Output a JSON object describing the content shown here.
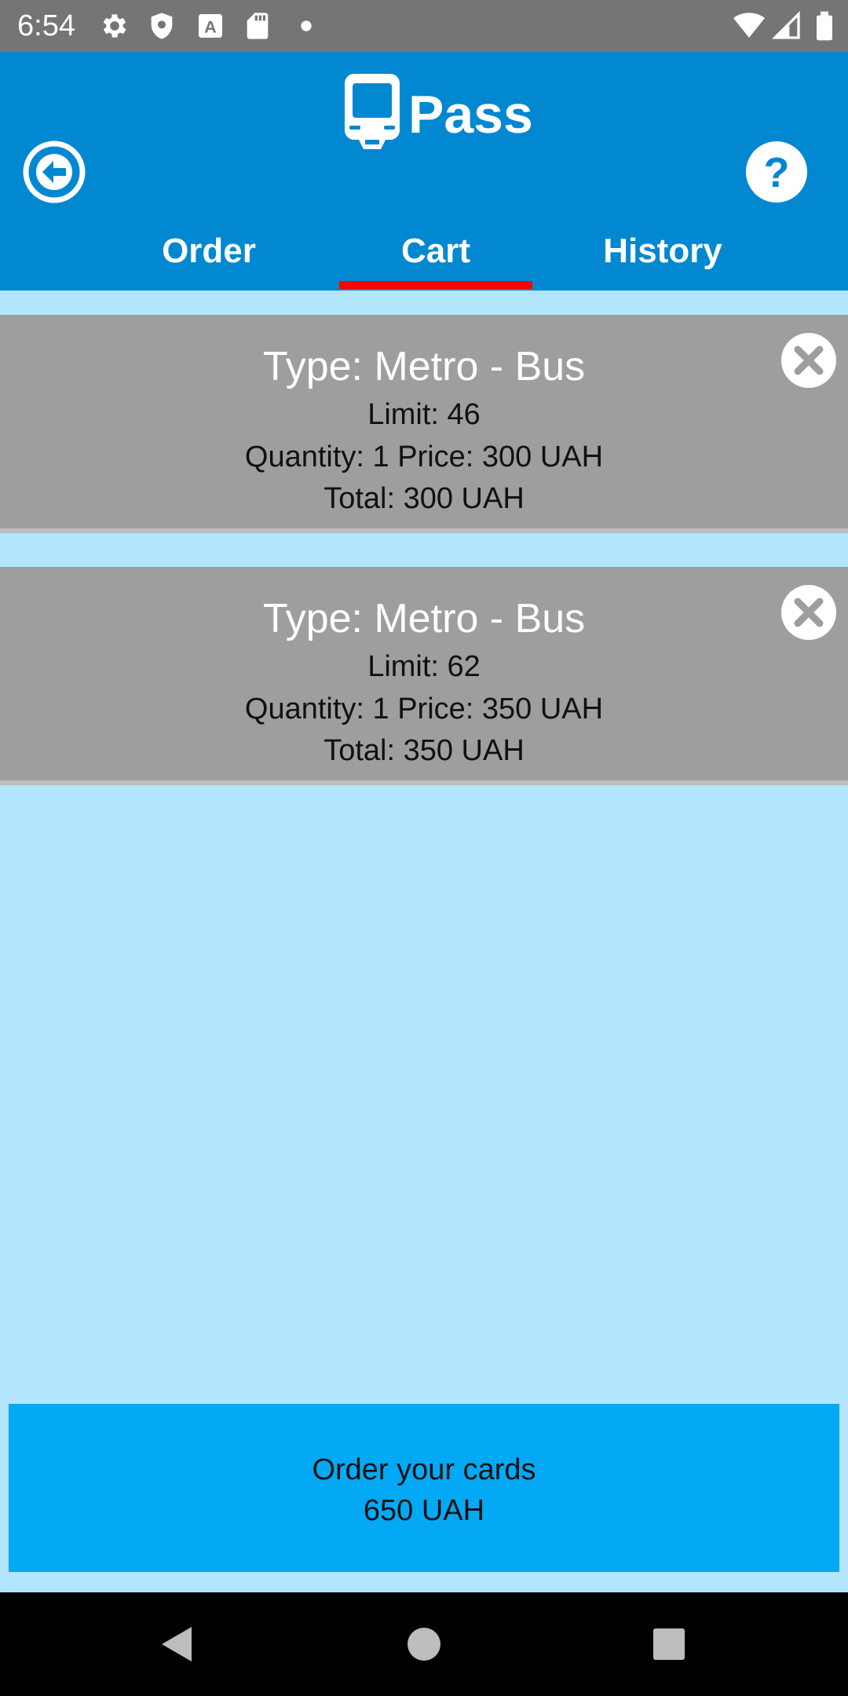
{
  "status_bar": {
    "time": "6:54",
    "icons": [
      "settings-gear-icon",
      "shield-icon",
      "a-keyboard-icon",
      "sd-card-icon",
      "dot-icon",
      "wifi-icon",
      "signal-icon",
      "battery-icon"
    ]
  },
  "header": {
    "title": "Pass",
    "logo_icon": "metro-train-icon",
    "back_icon": "back-arrow-circle-icon",
    "help_icon": "help-question-circle-icon",
    "tabs": [
      {
        "label": "Order",
        "active": false
      },
      {
        "label": "Cart",
        "active": true
      },
      {
        "label": "History",
        "active": false
      }
    ],
    "active_indicator_color": "#ff0000",
    "color": "#0288d1"
  },
  "cart": {
    "items": [
      {
        "type": "Type: Metro - Bus",
        "limit": "Limit:  46",
        "quantity_price": "Quantity:  1 Price:  300 UAH",
        "total": "Total: 300 UAH",
        "remove_icon": "close-circle-icon"
      },
      {
        "type": "Type: Metro - Bus",
        "limit": "Limit:  62",
        "quantity_price": "Quantity:  1 Price:  350 UAH",
        "total": "Total: 350 UAH",
        "remove_icon": "close-circle-icon"
      }
    ]
  },
  "order_button": {
    "label": "Order your cards",
    "total": "650 UAH",
    "color": "#03a9f4"
  },
  "nav_bar": {
    "icons": [
      "back-triangle-icon",
      "home-circle-icon",
      "recents-square-icon"
    ]
  }
}
